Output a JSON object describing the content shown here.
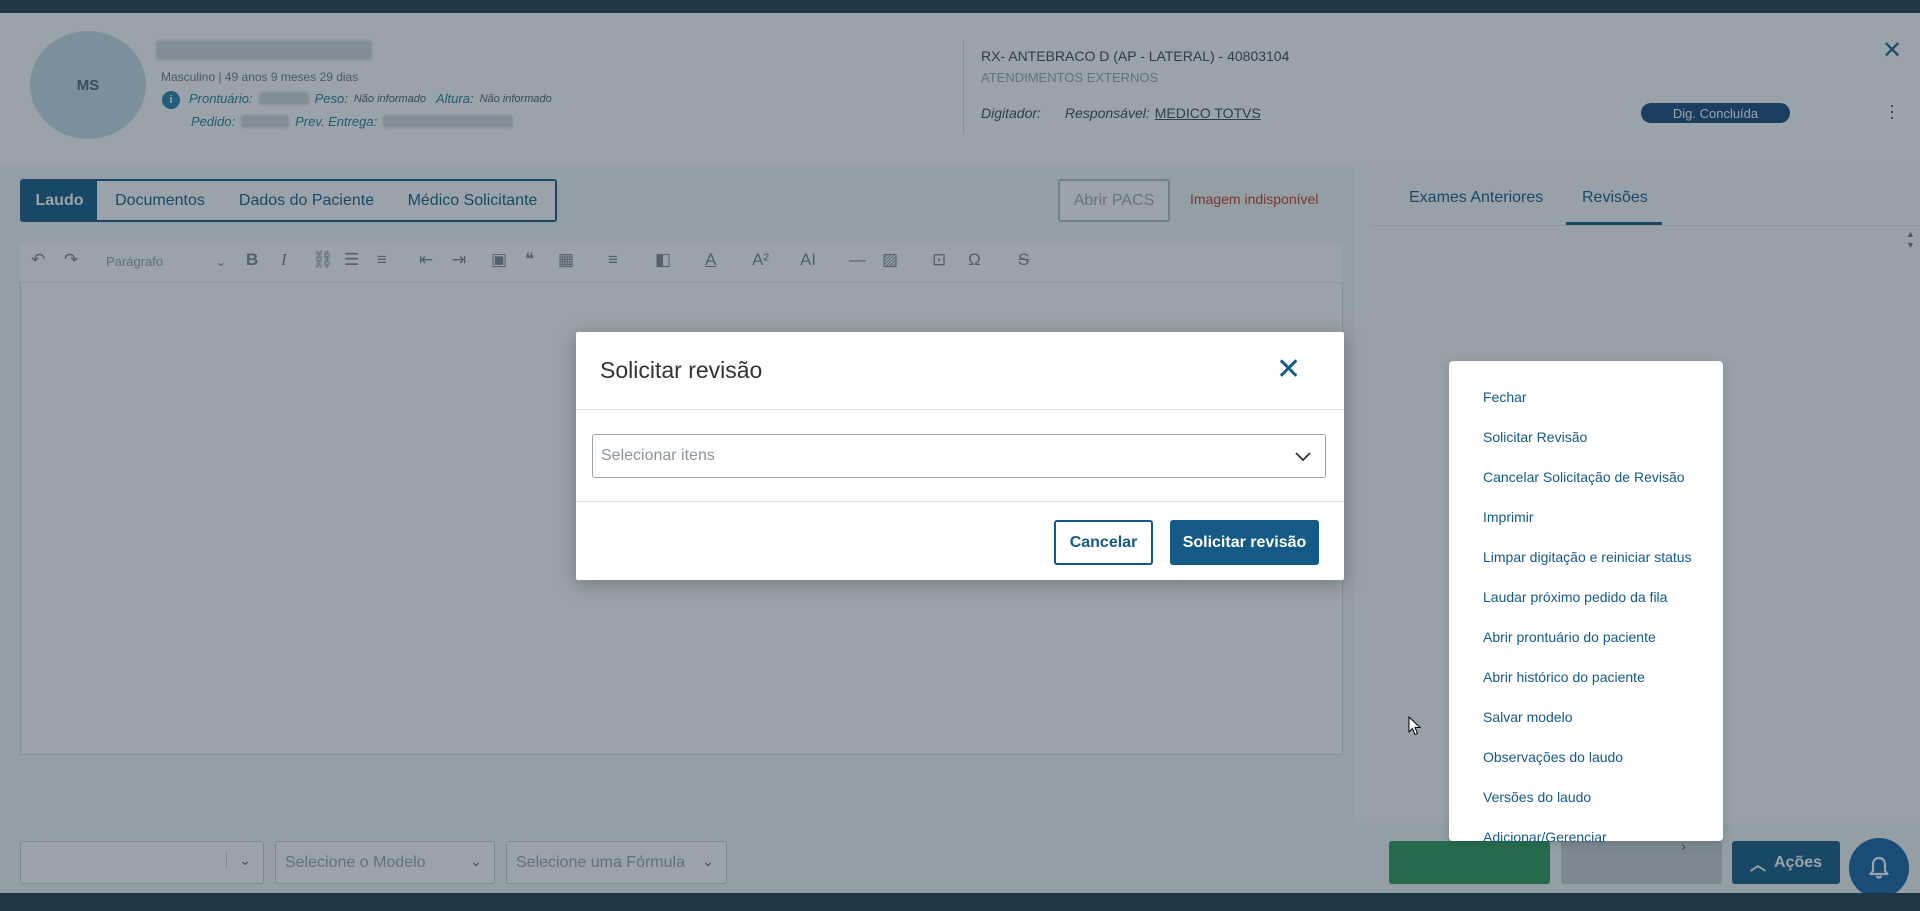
{
  "patient": {
    "initials": "MS",
    "sub": "Masculino | 49 anos 9 meses 29 dias",
    "prontuario_label": "Prontuário:",
    "peso_label": "Peso:",
    "peso_value": "Não informado",
    "altura_label": "Altura:",
    "altura_value": "Não informado",
    "pedido_label": "Pedido:",
    "prev_entrega_label": "Prev. Entrega:"
  },
  "exam": {
    "title": "RX- ANTEBRACO D (AP - LATERAL) - 40803104",
    "subtitle": "ATENDIMENTOS EXTERNOS",
    "digitador_label": "Digitador:",
    "responsavel_label": "Responsável:",
    "responsavel_value": "MEDICO TOTVS",
    "status": "Dig. Concluída"
  },
  "tabs": {
    "laudo": "Laudo",
    "documentos": "Documentos",
    "dados_paciente": "Dados do Paciente",
    "medico_solicitante": "Médico Solicitante"
  },
  "pacs": {
    "button": "Abrir PACS",
    "message": "Imagem indisponível"
  },
  "editor": {
    "paragraph_style": "Parágrafo"
  },
  "right_panel": {
    "tab_exames": "Exames Anteriores",
    "tab_revisoes": "Revisões"
  },
  "footer": {
    "modelo_placeholder": "Selecione o Modelo",
    "formula_placeholder": "Selecione uma Fórmula",
    "acoes_label": "Ações"
  },
  "actions_menu": {
    "items": [
      "Fechar",
      "Solicitar Revisão",
      "Cancelar Solicitação de Revisão",
      "Imprimir",
      "Limpar digitação e reiniciar status",
      "Laudar próximo pedido da fila",
      "Abrir prontuário do paciente",
      "Abrir histórico do paciente",
      "Salvar modelo",
      "Observações do laudo",
      "Versões do laudo",
      "Adicionar/Gerenciar"
    ]
  },
  "modal": {
    "title": "Solicitar revisão",
    "select_placeholder": "Selecionar itens",
    "cancel_label": "Cancelar",
    "submit_label": "Solicitar revisão"
  },
  "colors": {
    "primary": "#145a86",
    "success": "#2e9a5a",
    "danger": "#c0392b",
    "badge": "#16477a"
  }
}
